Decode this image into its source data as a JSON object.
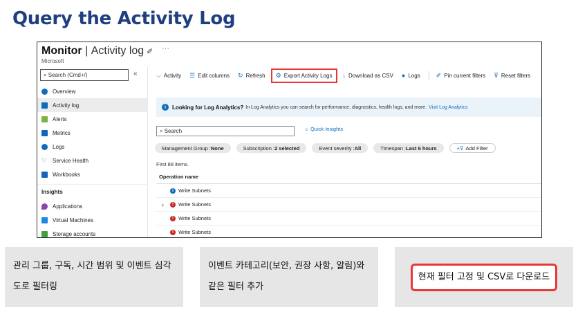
{
  "slide": {
    "title": "Query the Activity Log",
    "captions": [
      "관리 그룹, 구독, 시간 범위 및 이벤트 심각도로 필터링",
      "이벤트 카테고리(보안, 권장 사항, 알림)와 같은 필터 추가",
      "현재 필터 고정 및 CSV로 다운로드"
    ]
  },
  "colors": {
    "title": "#1f3f7f",
    "accent": "#0f6cbd",
    "highlight": "#e53935",
    "error": "#c62828"
  },
  "app": {
    "title": "Monitor",
    "separator": "|",
    "blade": "Activity log",
    "subtitle": "Microsoft",
    "pin_icon": "pin-icon",
    "more_label": "···"
  },
  "sidebar": {
    "search_placeholder": "Search (Cmd+/)",
    "collapse_label": "«",
    "items": [
      {
        "label": "Overview",
        "icon": "overview-icon",
        "color": "#0f6cbd"
      },
      {
        "label": "Activity log",
        "icon": "activity-log-icon",
        "color": "#0f6cbd",
        "active": true
      },
      {
        "label": "Alerts",
        "icon": "alerts-icon",
        "color": "#7cb342"
      },
      {
        "label": "Metrics",
        "icon": "metrics-icon",
        "color": "#1565c0"
      },
      {
        "label": "Logs",
        "icon": "logs-icon",
        "color": "#0f6cbd"
      },
      {
        "label": "Service Health",
        "icon": "heart-icon",
        "color": "#555555"
      },
      {
        "label": "Workbooks",
        "icon": "workbooks-icon",
        "color": "#1565c0"
      }
    ],
    "section": "Insights",
    "insights": [
      {
        "label": "Applications",
        "icon": "applications-icon",
        "color": "#8e44ad"
      },
      {
        "label": "Virtual Machines",
        "icon": "virtual-machines-icon",
        "color": "#1e88e5"
      },
      {
        "label": "Storage accounts",
        "icon": "storage-accounts-icon",
        "color": "#43a047"
      }
    ]
  },
  "toolbar": {
    "activity": "Activity",
    "edit_columns": "Edit columns",
    "refresh": "Refresh",
    "export": "Export Activity Logs",
    "download_csv": "Download as CSV",
    "logs": "Logs",
    "pin_filters": "Pin current filters",
    "reset_filters": "Reset filters"
  },
  "info": {
    "bold": "Looking for Log Analytics?",
    "text": "In Log Analytics you can search for performance, diagnostics, health logs, and more.",
    "link": "Visit Log Analytics"
  },
  "search": {
    "placeholder": "Search",
    "quick_insights": "Quick Insights"
  },
  "filters": [
    {
      "label": "Management Group : ",
      "value": "None"
    },
    {
      "label": "Subscription : ",
      "value": "2 selected"
    },
    {
      "label": "Event severity : ",
      "value": "All"
    },
    {
      "label": "Timespan : ",
      "value": "Last 6 hours"
    }
  ],
  "add_filter": "Add Filter",
  "list": {
    "count": "First 88 items.",
    "column": "Operation name",
    "rows": [
      {
        "name": "Write Subnets",
        "status": "info",
        "expandable": false
      },
      {
        "name": "Write Subnets",
        "status": "error",
        "expandable": true
      },
      {
        "name": "Write Subnets",
        "status": "error",
        "expandable": false
      },
      {
        "name": "Write Subnets",
        "status": "error",
        "expandable": false
      }
    ]
  }
}
